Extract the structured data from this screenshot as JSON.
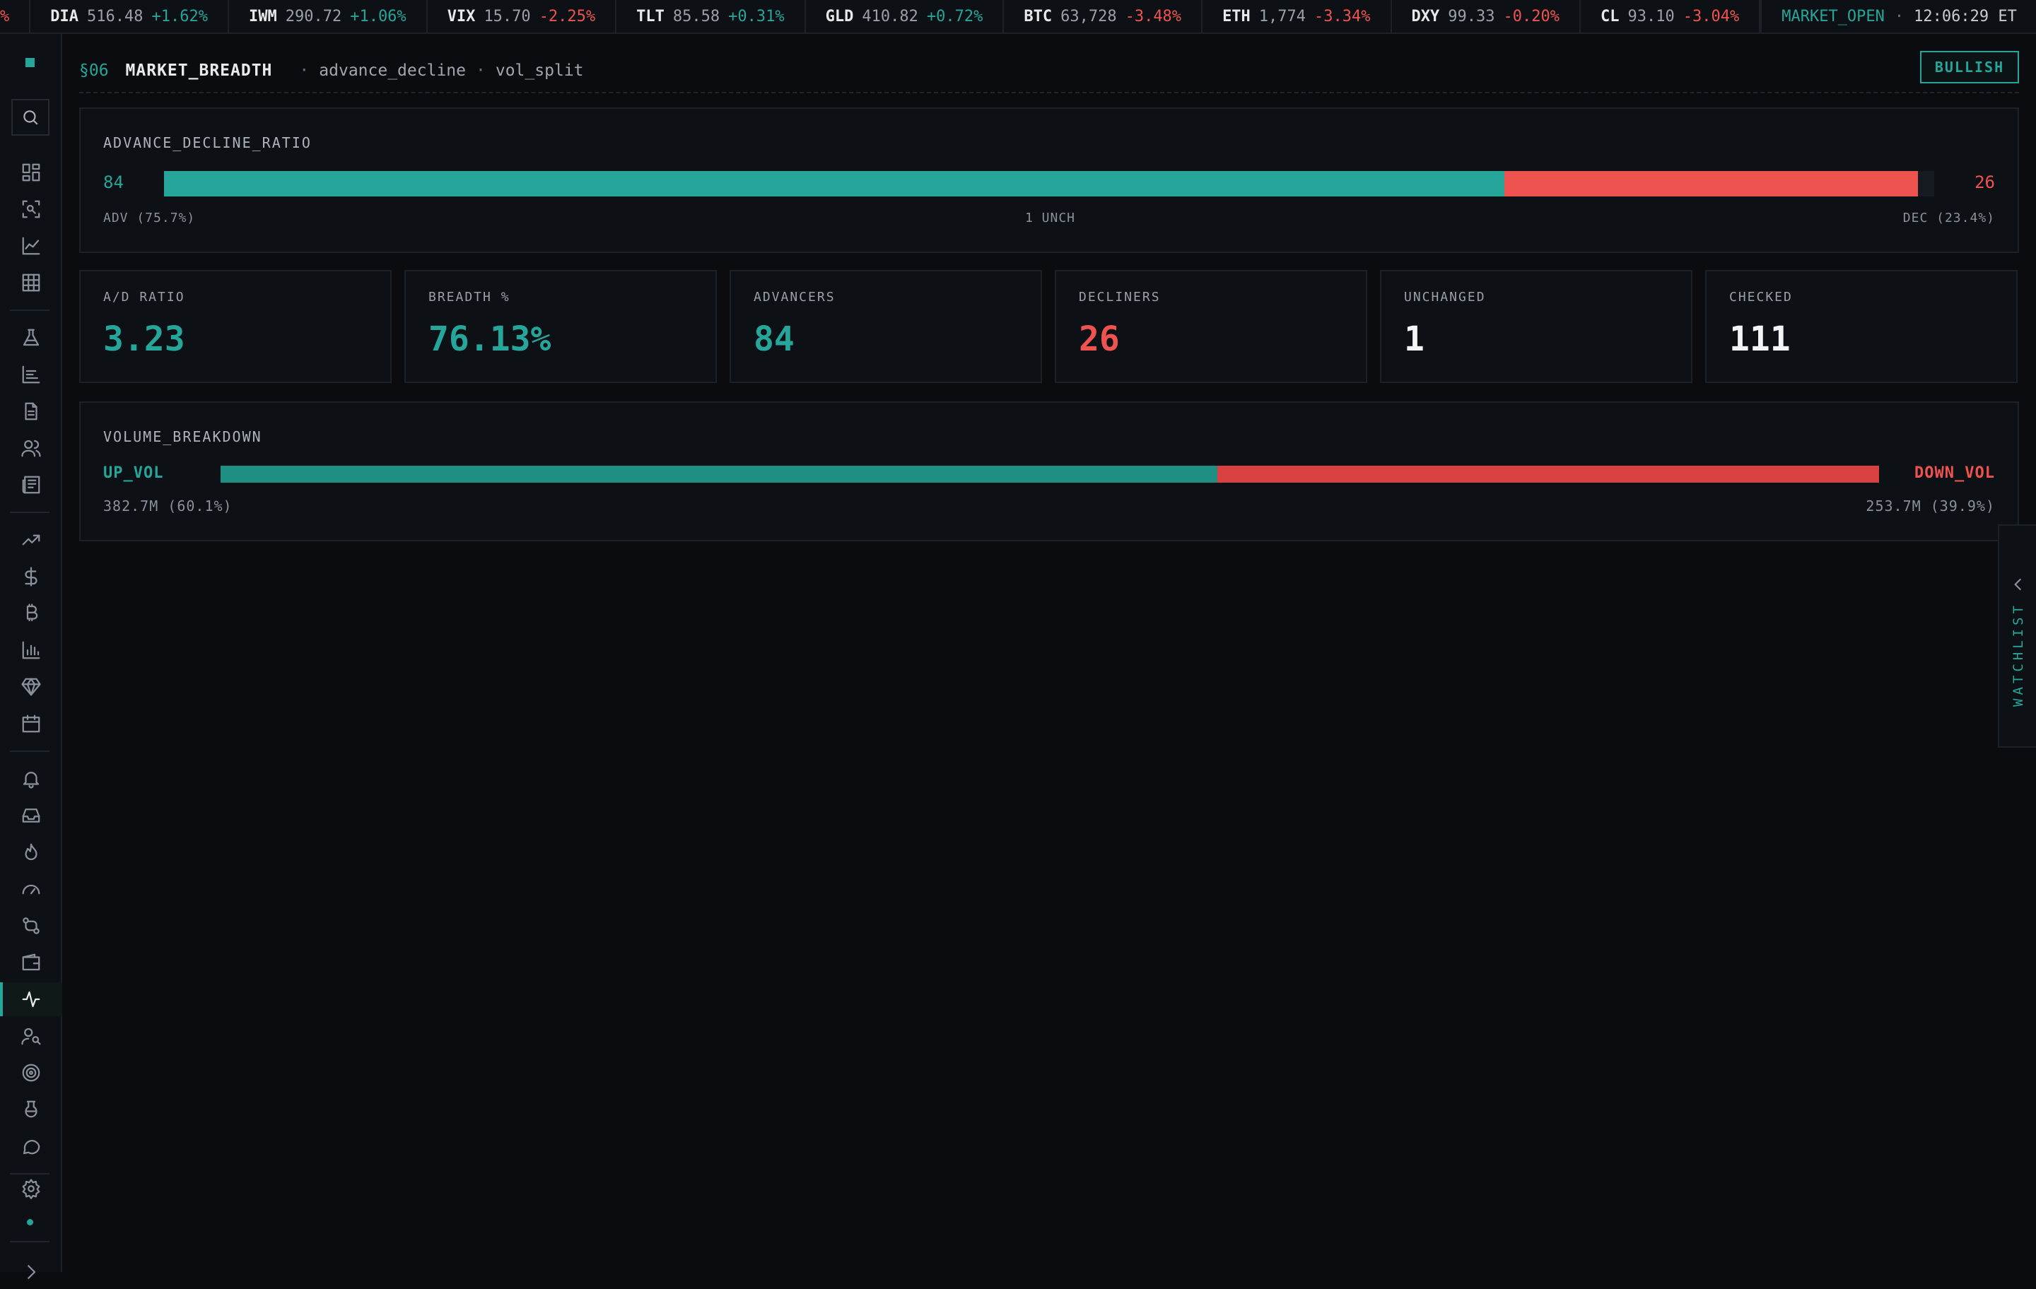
{
  "ticker": {
    "cut_fragment": "%",
    "items": [
      {
        "symbol": "DIA",
        "price": "516.48",
        "change": "+1.62%",
        "dir": "up"
      },
      {
        "symbol": "IWM",
        "price": "290.72",
        "change": "+1.06%",
        "dir": "up"
      },
      {
        "symbol": "VIX",
        "price": "15.70",
        "change": "-2.25%",
        "dir": "down"
      },
      {
        "symbol": "TLT",
        "price": "85.58",
        "change": "+0.31%",
        "dir": "up"
      },
      {
        "symbol": "GLD",
        "price": "410.82",
        "change": "+0.72%",
        "dir": "up"
      },
      {
        "symbol": "BTC",
        "price": "63,728",
        "change": "-3.48%",
        "dir": "down"
      },
      {
        "symbol": "ETH",
        "price": "1,774",
        "change": "-3.34%",
        "dir": "down"
      },
      {
        "symbol": "DXY",
        "price": "99.33",
        "change": "-0.20%",
        "dir": "down"
      },
      {
        "symbol": "CL",
        "price": "93.10",
        "change": "-3.04%",
        "dir": "down"
      }
    ],
    "market_status": "MARKET_OPEN",
    "separator": "·",
    "clock": "12:06:29 ET"
  },
  "sidebar": {
    "icons": [
      "search-icon",
      "dashboard-icon",
      "scan-icon",
      "line-chart-icon",
      "grid-icon",
      "flask-icon",
      "bar-list-icon",
      "document-icon",
      "users-icon",
      "newspaper-icon",
      "trending-up-icon",
      "dollar-icon",
      "bitcoin-icon",
      "bar-chart-icon",
      "diamond-icon",
      "calendar-icon",
      "bell-icon",
      "inbox-icon",
      "flame-icon",
      "gauge-icon",
      "swap-icon",
      "wallet-icon",
      "pulse-icon",
      "user-search-icon",
      "target-icon",
      "beaker-icon",
      "chat-icon",
      "gear-icon",
      "chevron-right-icon"
    ],
    "active": "pulse-icon"
  },
  "header": {
    "section": "§06",
    "title": "MARKET_BREADTH",
    "sep": "·",
    "crumbs": [
      "advance_decline",
      "vol_split"
    ],
    "badge": "BULLISH"
  },
  "advance_decline": {
    "title": "ADVANCE_DECLINE_RATIO",
    "advancers": "84",
    "decliners": "26",
    "adv_fraction": 0.757,
    "dec_fraction": 0.234,
    "adv_label": "ADV (75.7%)",
    "unch_label": "1 UNCH",
    "dec_label": "DEC (23.4%)"
  },
  "stats": [
    {
      "label": "A/D RATIO",
      "value": "3.23",
      "tone": "up"
    },
    {
      "label": "BREADTH %",
      "value": "76.13%",
      "tone": "up"
    },
    {
      "label": "ADVANCERS",
      "value": "84",
      "tone": "up"
    },
    {
      "label": "DECLINERS",
      "value": "26",
      "tone": "down"
    },
    {
      "label": "UNCHANGED",
      "value": "1",
      "tone": "white"
    },
    {
      "label": "CHECKED",
      "value": "111",
      "tone": "white"
    }
  ],
  "volume": {
    "title": "VOLUME_BREAKDOWN",
    "up_label": "UP_VOL",
    "down_label": "DOWN_VOL",
    "up_fraction": 0.601,
    "down_fraction": 0.399,
    "up_text": "382.7M (60.1%)",
    "down_text": "253.7M (39.9%)"
  },
  "watchlist": {
    "label": "WATCHLIST"
  },
  "colors": {
    "accent": "#26a69a",
    "up": "#26a69a",
    "down": "#ef5350",
    "background": "#0a0c10",
    "panel": "#0d1014"
  }
}
